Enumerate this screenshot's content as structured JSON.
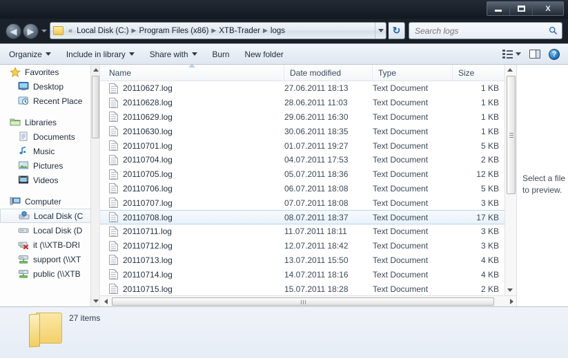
{
  "window": {
    "controls": [
      {
        "name": "minimize",
        "glyph": "minimize-icon"
      },
      {
        "name": "maximize",
        "glyph": "maximize-icon"
      },
      {
        "name": "close",
        "glyph": "X"
      }
    ]
  },
  "nav": {
    "back_glyph": "◀",
    "forward_glyph": "▶",
    "breadcrumb_overflow": "«",
    "crumbs": [
      "Local Disk (C:)",
      "Program Files (x86)",
      "XTB-Trader",
      "logs"
    ],
    "separator": "▶",
    "refresh_glyph": "↻"
  },
  "search": {
    "placeholder": "Search logs",
    "value": "",
    "icon_glyph": "⚲"
  },
  "toolbar": {
    "items": [
      {
        "label": "Organize",
        "has_dropdown": true
      },
      {
        "label": "Include in library",
        "has_dropdown": true
      },
      {
        "label": "Share with",
        "has_dropdown": true
      },
      {
        "label": "Burn",
        "has_dropdown": false
      },
      {
        "label": "New folder",
        "has_dropdown": false
      }
    ],
    "view_dropdown": true,
    "preview_pane_toggle": true,
    "help_glyph": "?"
  },
  "sidebar": {
    "groups": [
      {
        "header": "Favorites",
        "icon": "star-icon",
        "items": [
          {
            "label": "Desktop",
            "icon": "desktop-icon"
          },
          {
            "label": "Recent Place",
            "icon": "recent-places-icon"
          }
        ]
      },
      {
        "header": "Libraries",
        "icon": "libraries-icon",
        "items": [
          {
            "label": "Documents",
            "icon": "documents-icon"
          },
          {
            "label": "Music",
            "icon": "music-icon"
          },
          {
            "label": "Pictures",
            "icon": "pictures-icon"
          },
          {
            "label": "Videos",
            "icon": "videos-icon"
          }
        ]
      },
      {
        "header": "Computer",
        "icon": "computer-icon",
        "items": [
          {
            "label": "Local Disk (C",
            "icon": "system-drive-icon",
            "selected": true
          },
          {
            "label": "Local Disk (D",
            "icon": "drive-icon"
          },
          {
            "label": "it (\\\\XTB-DRI",
            "icon": "disconnected-network-drive-icon"
          },
          {
            "label": "support (\\\\XT",
            "icon": "network-drive-icon"
          },
          {
            "label": "public (\\\\XTB",
            "icon": "network-drive-icon"
          }
        ]
      }
    ]
  },
  "filelist": {
    "columns": [
      {
        "key": "name",
        "label": "Name",
        "sorted": "ascending"
      },
      {
        "key": "date",
        "label": "Date modified"
      },
      {
        "key": "type",
        "label": "Type"
      },
      {
        "key": "size",
        "label": "Size"
      }
    ],
    "rows": [
      {
        "name": "20110627.log",
        "date": "27.06.2011 18:13",
        "type": "Text Document",
        "size": "1 KB",
        "selected": false
      },
      {
        "name": "20110628.log",
        "date": "28.06.2011 11:03",
        "type": "Text Document",
        "size": "1 KB",
        "selected": false
      },
      {
        "name": "20110629.log",
        "date": "29.06.2011 16:30",
        "type": "Text Document",
        "size": "1 KB",
        "selected": false
      },
      {
        "name": "20110630.log",
        "date": "30.06.2011 18:35",
        "type": "Text Document",
        "size": "1 KB",
        "selected": false
      },
      {
        "name": "20110701.log",
        "date": "01.07.2011 19:27",
        "type": "Text Document",
        "size": "5 KB",
        "selected": false
      },
      {
        "name": "20110704.log",
        "date": "04.07.2011 17:53",
        "type": "Text Document",
        "size": "2 KB",
        "selected": false
      },
      {
        "name": "20110705.log",
        "date": "05.07.2011 18:36",
        "type": "Text Document",
        "size": "12 KB",
        "selected": false
      },
      {
        "name": "20110706.log",
        "date": "06.07.2011 18:08",
        "type": "Text Document",
        "size": "5 KB",
        "selected": false
      },
      {
        "name": "20110707.log",
        "date": "07.07.2011 18:08",
        "type": "Text Document",
        "size": "3 KB",
        "selected": false
      },
      {
        "name": "20110708.log",
        "date": "08.07.2011 18:37",
        "type": "Text Document",
        "size": "17 KB",
        "selected": true
      },
      {
        "name": "20110711.log",
        "date": "11.07.2011 18:11",
        "type": "Text Document",
        "size": "3 KB",
        "selected": false
      },
      {
        "name": "20110712.log",
        "date": "12.07.2011 18:42",
        "type": "Text Document",
        "size": "3 KB",
        "selected": false
      },
      {
        "name": "20110713.log",
        "date": "13.07.2011 15:50",
        "type": "Text Document",
        "size": "4 KB",
        "selected": false
      },
      {
        "name": "20110714.log",
        "date": "14.07.2011 18:16",
        "type": "Text Document",
        "size": "4 KB",
        "selected": false
      },
      {
        "name": "20110715.log",
        "date": "15.07.2011 18:28",
        "type": "Text Document",
        "size": "2 KB",
        "selected": false
      }
    ]
  },
  "preview": {
    "line1": "Select a file",
    "line2": "to preview."
  },
  "status": {
    "item_count": "27 items",
    "folder_icon": "folder-icon"
  },
  "colors": {
    "accent": "#1f6fba",
    "selection": "#e8f1fa",
    "selection_border": "#b9d4ec",
    "toolbar": "#e8eef6",
    "statusbar": "#eff3f9"
  }
}
